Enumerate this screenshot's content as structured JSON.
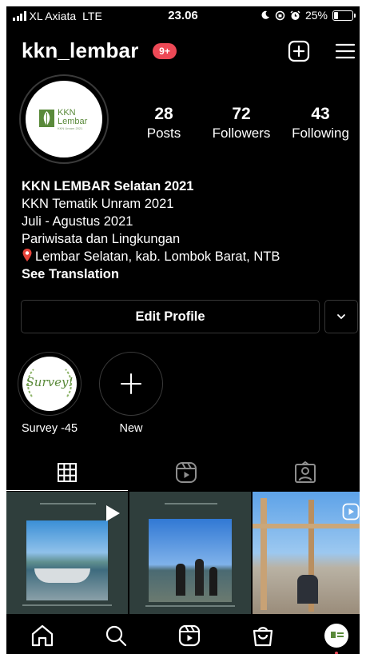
{
  "status_bar": {
    "carrier": "XL Axiata",
    "network": "LTE",
    "time": "23.06",
    "battery": "25%"
  },
  "header": {
    "username": "kkn_lembar",
    "notification_badge": "9+"
  },
  "profile": {
    "avatar_logo": {
      "line1": "KKN",
      "line2": "Lembar",
      "line3": "KKN Unram 2021"
    },
    "stats": [
      {
        "value": "28",
        "label": "Posts"
      },
      {
        "value": "72",
        "label": "Followers"
      },
      {
        "value": "43",
        "label": "Following"
      }
    ],
    "bio": {
      "name": "KKN LEMBAR Selatan 2021",
      "line1": "KKN Tematik Unram 2021",
      "line2": "Juli - Agustus 2021",
      "line3": "Pariwisata dan Lingkungan",
      "location": "Lembar Selatan, kab. Lombok Barat, NTB",
      "see_translation": "See Translation"
    },
    "edit_profile_label": "Edit Profile"
  },
  "highlights": [
    {
      "label": "Survey -45",
      "cover_text": "Survey!"
    },
    {
      "label": "New"
    }
  ],
  "tabs": [
    "grid",
    "reels",
    "tagged"
  ],
  "active_tab": "grid",
  "posts": [
    {
      "kind": "photo-card",
      "has_reels_icon": true
    },
    {
      "kind": "photo-card",
      "has_reels_icon": false
    },
    {
      "kind": "photo",
      "has_reels_icon": true
    }
  ],
  "bottom_nav": [
    "home",
    "search",
    "reels",
    "shop",
    "profile"
  ],
  "colors": {
    "background": "#000000",
    "badge": "#ed4956",
    "border": "#363636",
    "logo_green": "#5a8a3a"
  }
}
